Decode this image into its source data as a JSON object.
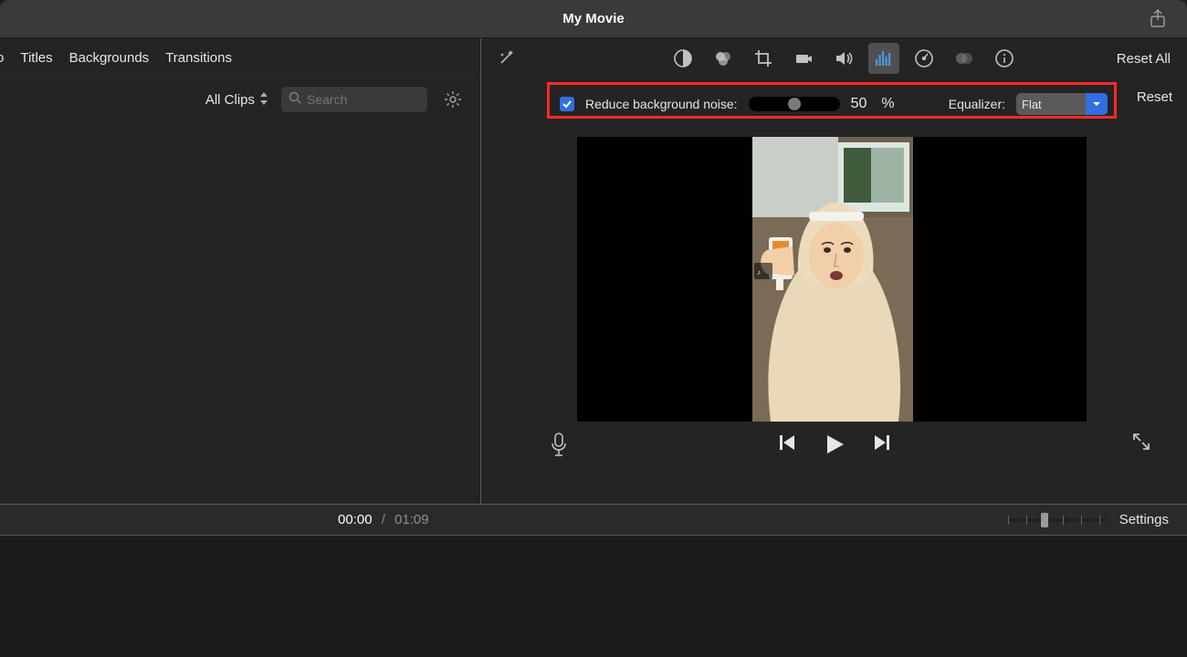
{
  "titlebar": {
    "title": "My Movie"
  },
  "left": {
    "tabs": {
      "partial": "o",
      "titles": "Titles",
      "backgrounds": "Backgrounds",
      "transitions": "Transitions"
    },
    "clips_label": "All Clips",
    "search_placeholder": "Search"
  },
  "right": {
    "reset_all": "Reset All",
    "noise": {
      "checked": true,
      "label": "Reduce background noise:",
      "value": "50",
      "unit": "%",
      "slider_pct": 50
    },
    "equalizer": {
      "label": "Equalizer:",
      "value": "Flat"
    },
    "reset": "Reset"
  },
  "timeline": {
    "current": "00:00",
    "sep": "/",
    "duration": "01:09",
    "settings": "Settings"
  },
  "icons": {
    "share": "share-icon",
    "wand": "wand-icon",
    "balance": "color-balance-icon",
    "palette": "color-correction-icon",
    "crop": "crop-icon",
    "camera": "stabilization-icon",
    "volume": "volume-icon",
    "eq": "noise-eq-icon",
    "speed": "speed-icon",
    "filter": "clip-filter-icon",
    "info": "info-icon",
    "gear": "gear-icon",
    "mic": "microphone-icon",
    "prev": "previous-icon",
    "play": "play-icon",
    "next": "next-icon",
    "fullscreen": "fullscreen-icon",
    "search": "search-icon",
    "chk": "checkmark-icon",
    "chev": "chevron-down-icon"
  }
}
